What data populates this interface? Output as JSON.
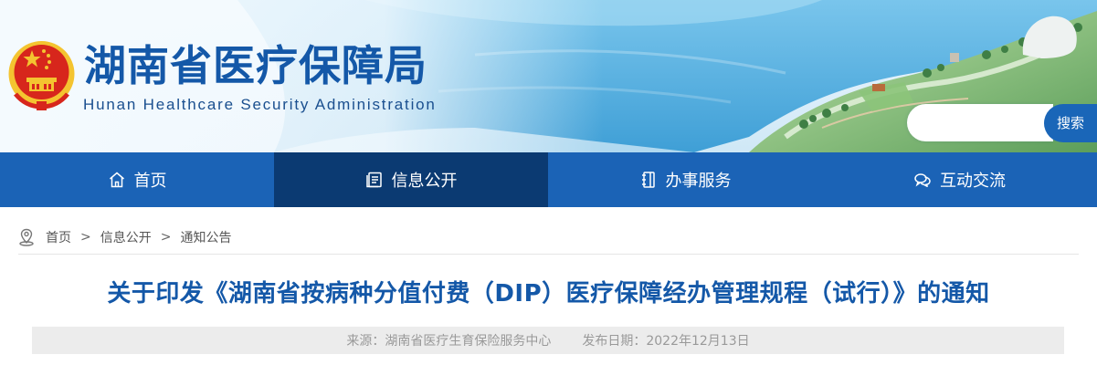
{
  "header": {
    "site_title": "湖南省医疗保障局",
    "site_subtitle": "Hunan Healthcare Security Administration",
    "emblem_icon": "national-emblem-icon"
  },
  "search": {
    "placeholder": "",
    "button_label": "搜索"
  },
  "nav": {
    "items": [
      {
        "label": "首页",
        "icon": "home-icon",
        "active": false
      },
      {
        "label": "信息公开",
        "icon": "document-list-icon",
        "active": true
      },
      {
        "label": "办事服务",
        "icon": "notebook-icon",
        "active": false
      },
      {
        "label": "互动交流",
        "icon": "chat-bubbles-icon",
        "active": false
      }
    ]
  },
  "breadcrumb": {
    "icon": "location-pin-icon",
    "items": [
      "首页",
      "信息公开",
      "通知公告"
    ],
    "separator": ">"
  },
  "article": {
    "title": "关于印发《湖南省按病种分值付费（DIP）医疗保障经办管理规程（试行）》的通知",
    "source": "来源：湖南省医疗生育保险服务中心",
    "publish_date": "发布日期：2022年12月13日"
  },
  "colors": {
    "brand_blue": "#1b63b6",
    "nav_active": "#0b3a72",
    "title_blue": "#1458a8",
    "emblem_red": "#d7261c",
    "emblem_gold": "#f4c430"
  }
}
